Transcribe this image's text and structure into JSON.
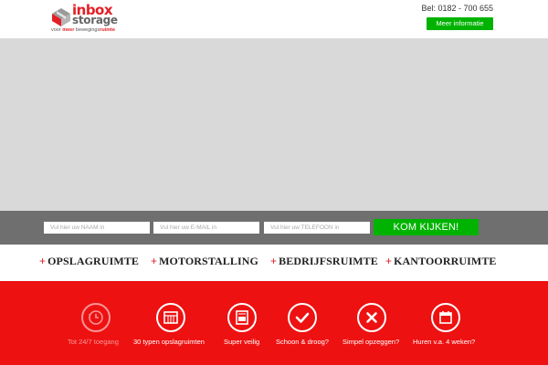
{
  "header": {
    "logo": {
      "word1": "inbox",
      "word2": "storage",
      "tagline_start": "voor ",
      "tagline_meer": "meer",
      "tagline_middle": " bewegings",
      "tagline_end": "ruimte"
    },
    "phone": "Bel: 0182 - 700 655",
    "more_button": "Meer informatie"
  },
  "form": {
    "name_placeholder": "Vul hier uw NAAM in",
    "email_placeholder": "Vul hier uw E-MAIL in",
    "phone_placeholder": "Vul hier uw TELEFOON in",
    "submit_label": "KOM KIJKEN!"
  },
  "categories": [
    {
      "plus": "+",
      "label": "OPSLAGRUIMTE"
    },
    {
      "plus": "+",
      "label": "MOTORSTALLING"
    },
    {
      "plus": "+",
      "label": "BEDRIJFSRUIMTE"
    },
    {
      "plus": "+",
      "label": "KANTOORRUIMTE"
    }
  ],
  "features": [
    {
      "icon": "clock-icon",
      "label": "Tot 24/7 toegang",
      "dim": true
    },
    {
      "icon": "storage-units-icon",
      "label": "30 typen opslagruimten",
      "dim": false
    },
    {
      "icon": "safe-icon",
      "label": "Super veilig",
      "dim": false
    },
    {
      "icon": "checkmark-icon",
      "label": "Schoon & droog?",
      "dim": false
    },
    {
      "icon": "cross-icon",
      "label": "Simpel opzeggen?",
      "dim": false
    },
    {
      "icon": "calendar-icon",
      "label": "Huren v.a. 4 weken?",
      "dim": false
    }
  ],
  "colors": {
    "brand_red": "#e41f26",
    "feature_red": "#ee1111",
    "accent_green": "#00b300",
    "hero_gray": "#d9d9d9",
    "formbar_gray": "#6f6f6f"
  }
}
